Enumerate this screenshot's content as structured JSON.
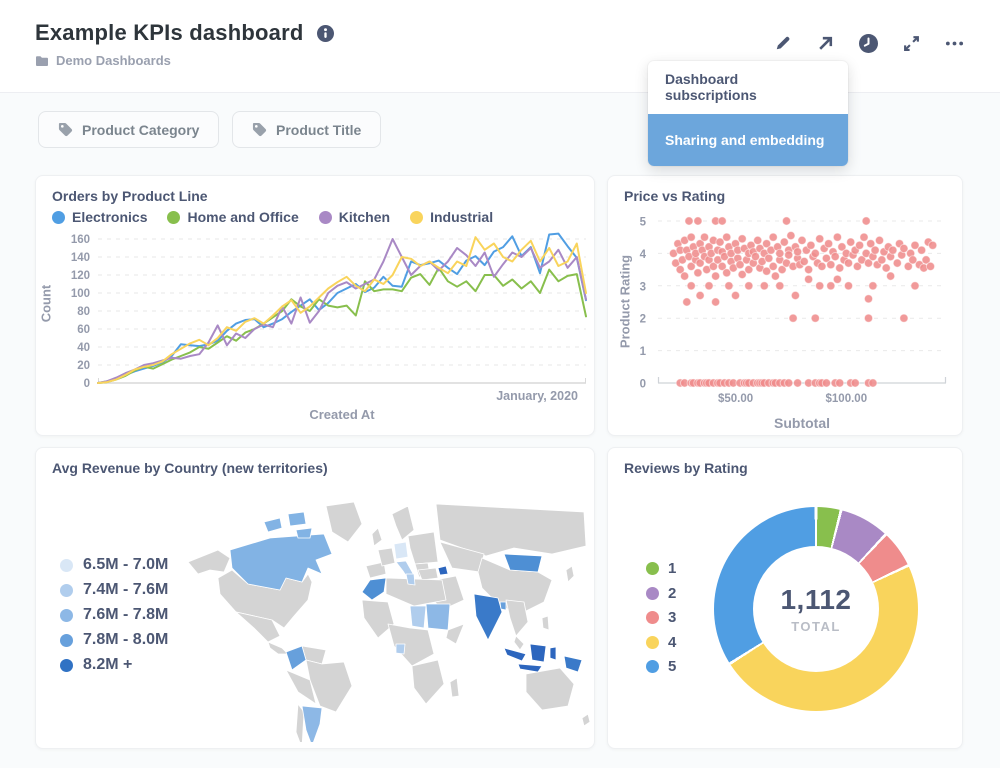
{
  "header": {
    "title": "Example KPIs dashboard",
    "breadcrumb": "Demo Dashboards",
    "actions": [
      "edit",
      "share",
      "time",
      "fullscreen",
      "more"
    ]
  },
  "menu": {
    "items": [
      {
        "label": "Dashboard subscriptions",
        "active": false
      },
      {
        "label": "Sharing and embedding",
        "active": true
      }
    ]
  },
  "filters": [
    {
      "label": "Product Category"
    },
    {
      "label": "Product Title"
    }
  ],
  "colors": {
    "brand": "#509ee3",
    "menu_highlight": "#6ca6dc",
    "map_base": "#d4d4d4"
  },
  "chart_data": [
    {
      "type": "line",
      "title": "Orders by Product Line",
      "xlabel": "Created At",
      "ylabel": "Count",
      "x_end_label": "January, 2020",
      "ylim": [
        0,
        170
      ],
      "yticks": [
        0,
        20,
        40,
        60,
        80,
        100,
        120,
        140,
        160
      ],
      "grid": true,
      "legend_position": "top",
      "series": [
        {
          "name": "Electronics",
          "color": "#509ee3",
          "values": [
            0,
            2,
            5,
            9,
            13,
            16,
            19,
            23,
            30,
            43,
            42,
            41,
            43,
            47,
            58,
            66,
            70,
            71,
            62,
            66,
            71,
            79,
            86,
            93,
            81,
            89,
            100,
            105,
            110,
            101,
            106,
            118,
            108,
            107,
            135,
            131,
            133,
            136,
            128,
            121,
            136,
            141,
            131,
            146,
            151,
            163,
            141,
            151,
            122,
            165,
            166,
            152,
            139,
            92
          ]
        },
        {
          "name": "Home and Office",
          "color": "#88bf4d",
          "values": [
            0,
            1,
            4,
            8,
            14,
            18,
            16,
            21,
            26,
            30,
            34,
            40,
            38,
            45,
            52,
            47,
            56,
            60,
            66,
            73,
            80,
            93,
            85,
            80,
            93,
            86,
            84,
            86,
            75,
            113,
            102,
            104,
            104,
            102,
            117,
            121,
            109,
            128,
            113,
            107,
            113,
            102,
            120,
            120,
            108,
            115,
            105,
            113,
            100,
            126,
            113,
            119,
            121,
            74
          ]
        },
        {
          "name": "Kitchen",
          "color": "#a989c5",
          "values": [
            0,
            2,
            6,
            11,
            15,
            20,
            22,
            25,
            28,
            27,
            30,
            32,
            45,
            64,
            42,
            55,
            50,
            60,
            65,
            62,
            85,
            66,
            95,
            67,
            80,
            100,
            108,
            112,
            105,
            110,
            115,
            135,
            160,
            140,
            120,
            130,
            135,
            125,
            135,
            150,
            142,
            130,
            145,
            118,
            132,
            145,
            140,
            150,
            128,
            135,
            148,
            128,
            140,
            93
          ]
        },
        {
          "name": "Industrial",
          "color": "#f9d45c",
          "values": [
            0,
            1,
            4,
            9,
            15,
            18,
            20,
            24,
            32,
            38,
            44,
            48,
            42,
            50,
            62,
            58,
            68,
            72,
            66,
            75,
            85,
            92,
            78,
            85,
            95,
            105,
            112,
            118,
            108,
            102,
            115,
            110,
            120,
            140,
            138,
            130,
            135,
            128,
            122,
            135,
            130,
            162,
            148,
            155,
            140,
            135,
            148,
            158,
            135,
            150,
            130,
            135,
            155,
            100
          ]
        }
      ]
    },
    {
      "type": "scatter",
      "title": "Price vs Rating",
      "xlabel": "Subtotal",
      "ylabel": "Product Rating",
      "color": "#ef8c8c",
      "xlim": [
        15,
        145
      ],
      "ylim": [
        0,
        5
      ],
      "yticks": [
        0,
        1,
        2,
        3,
        4,
        5
      ],
      "xticks": [
        {
          "v": 50,
          "label": "$50.00"
        },
        {
          "v": 100,
          "label": "$100.00"
        }
      ],
      "points": [
        [
          22,
          4.0
        ],
        [
          23,
          3.7
        ],
        [
          24,
          4.3
        ],
        [
          25,
          3.5
        ],
        [
          25,
          4.1
        ],
        [
          26,
          3.8
        ],
        [
          27,
          4.4
        ],
        [
          27,
          3.3
        ],
        [
          28,
          4.1
        ],
        [
          29,
          3.9
        ],
        [
          30,
          4.5
        ],
        [
          30,
          3.6
        ],
        [
          31,
          4.2
        ],
        [
          32,
          3.8
        ],
        [
          32,
          4.0
        ],
        [
          33,
          3.4
        ],
        [
          34,
          4.3
        ],
        [
          34,
          3.7
        ],
        [
          35,
          4.1
        ],
        [
          36,
          3.9
        ],
        [
          36,
          4.5
        ],
        [
          37,
          3.5
        ],
        [
          38,
          4.2
        ],
        [
          38,
          3.8
        ],
        [
          39,
          4.0
        ],
        [
          40,
          3.6
        ],
        [
          40,
          4.4
        ],
        [
          41,
          3.3
        ],
        [
          42,
          4.1
        ],
        [
          42,
          3.8
        ],
        [
          43,
          4.35
        ],
        [
          44,
          3.6
        ],
        [
          44,
          4.05
        ],
        [
          45,
          3.9
        ],
        [
          46,
          4.5
        ],
        [
          46,
          3.4
        ],
        [
          47,
          4.2
        ],
        [
          48,
          3.75
        ],
        [
          48,
          4.0
        ],
        [
          49,
          3.55
        ],
        [
          50,
          4.3
        ],
        [
          51,
          3.85
        ],
        [
          51,
          4.1
        ],
        [
          52,
          3.65
        ],
        [
          53,
          4.45
        ],
        [
          53,
          3.35
        ],
        [
          54,
          4.15
        ],
        [
          55,
          3.8
        ],
        [
          56,
          4.0
        ],
        [
          56,
          3.5
        ],
        [
          57,
          4.25
        ],
        [
          58,
          3.7
        ],
        [
          58,
          4.05
        ],
        [
          59,
          3.9
        ],
        [
          60,
          4.4
        ],
        [
          61,
          3.55
        ],
        [
          61,
          4.15
        ],
        [
          62,
          3.75
        ],
        [
          63,
          4.0
        ],
        [
          64,
          3.45
        ],
        [
          64,
          4.3
        ],
        [
          65,
          3.85
        ],
        [
          66,
          4.1
        ],
        [
          67,
          3.6
        ],
        [
          67,
          4.5
        ],
        [
          68,
          3.3
        ],
        [
          69,
          4.2
        ],
        [
          70,
          3.8
        ],
        [
          70,
          4.0
        ],
        [
          71,
          3.5
        ],
        [
          72,
          4.35
        ],
        [
          73,
          3.7
        ],
        [
          74,
          4.1
        ],
        [
          74,
          3.95
        ],
        [
          75,
          4.55
        ],
        [
          76,
          3.6
        ],
        [
          77,
          4.2
        ],
        [
          78,
          3.85
        ],
        [
          78,
          4.05
        ],
        [
          79,
          3.65
        ],
        [
          80,
          4.4
        ],
        [
          81,
          3.75
        ],
        [
          82,
          4.1
        ],
        [
          83,
          3.5
        ],
        [
          84,
          4.25
        ],
        [
          85,
          3.9
        ],
        [
          86,
          4.0
        ],
        [
          87,
          3.7
        ],
        [
          88,
          4.45
        ],
        [
          89,
          3.6
        ],
        [
          90,
          4.15
        ],
        [
          91,
          3.85
        ],
        [
          92,
          4.3
        ],
        [
          93,
          3.65
        ],
        [
          94,
          4.05
        ],
        [
          95,
          3.9
        ],
        [
          96,
          4.5
        ],
        [
          97,
          3.55
        ],
        [
          98,
          4.2
        ],
        [
          99,
          3.8
        ],
        [
          100,
          4.0
        ],
        [
          101,
          3.7
        ],
        [
          102,
          4.35
        ],
        [
          103,
          3.95
        ],
        [
          104,
          4.1
        ],
        [
          105,
          3.6
        ],
        [
          106,
          4.25
        ],
        [
          107,
          3.8
        ],
        [
          108,
          4.5
        ],
        [
          109,
          4.0
        ],
        [
          110,
          3.7
        ],
        [
          111,
          4.3
        ],
        [
          112,
          3.9
        ],
        [
          113,
          4.1
        ],
        [
          114,
          3.65
        ],
        [
          115,
          4.4
        ],
        [
          116,
          3.8
        ],
        [
          117,
          4.05
        ],
        [
          118,
          3.55
        ],
        [
          119,
          4.2
        ],
        [
          120,
          3.9
        ],
        [
          121,
          4.1
        ],
        [
          123,
          3.7
        ],
        [
          124,
          4.3
        ],
        [
          125,
          3.95
        ],
        [
          126,
          4.15
        ],
        [
          128,
          3.6
        ],
        [
          129,
          4.0
        ],
        [
          130,
          3.8
        ],
        [
          131,
          4.25
        ],
        [
          133,
          3.65
        ],
        [
          134,
          4.1
        ],
        [
          135,
          3.55
        ],
        [
          136,
          3.8
        ],
        [
          137,
          4.35
        ],
        [
          138,
          3.6
        ],
        [
          139,
          4.25
        ],
        [
          25,
          0
        ],
        [
          27,
          0
        ],
        [
          30,
          0
        ],
        [
          31,
          0
        ],
        [
          33,
          0
        ],
        [
          34,
          0
        ],
        [
          36,
          0
        ],
        [
          37,
          0
        ],
        [
          38,
          0
        ],
        [
          40,
          0
        ],
        [
          42,
          0
        ],
        [
          43,
          0
        ],
        [
          45,
          0
        ],
        [
          47,
          0
        ],
        [
          49,
          0
        ],
        [
          52,
          0
        ],
        [
          54,
          0
        ],
        [
          55,
          0
        ],
        [
          56,
          0
        ],
        [
          58,
          0
        ],
        [
          60,
          0
        ],
        [
          61,
          0
        ],
        [
          62,
          0
        ],
        [
          63,
          0
        ],
        [
          65,
          0
        ],
        [
          67,
          0
        ],
        [
          68,
          0
        ],
        [
          70,
          0
        ],
        [
          72,
          0
        ],
        [
          74,
          0
        ],
        [
          78,
          0
        ],
        [
          83,
          0
        ],
        [
          86,
          0
        ],
        [
          88,
          0
        ],
        [
          89,
          0
        ],
        [
          91,
          0
        ],
        [
          95,
          0
        ],
        [
          97,
          0
        ],
        [
          102,
          0
        ],
        [
          104,
          0
        ],
        [
          110,
          0
        ],
        [
          112,
          0
        ],
        [
          29,
          5
        ],
        [
          33,
          5
        ],
        [
          41,
          5
        ],
        [
          44,
          5
        ],
        [
          73,
          5
        ],
        [
          109,
          5
        ],
        [
          28,
          2.5
        ],
        [
          34,
          2.7
        ],
        [
          41,
          2.5
        ],
        [
          50,
          2.7
        ],
        [
          77,
          2.7
        ],
        [
          110,
          2.6
        ],
        [
          76,
          2
        ],
        [
          86,
          2
        ],
        [
          110,
          2
        ],
        [
          126,
          2
        ],
        [
          30,
          3.0
        ],
        [
          38,
          3.0
        ],
        [
          47,
          3.0
        ],
        [
          56,
          3.0
        ],
        [
          63,
          3.0
        ],
        [
          70,
          3.0
        ],
        [
          88,
          3.0
        ],
        [
          93,
          3.0
        ],
        [
          101,
          3.0
        ],
        [
          112,
          3.0
        ],
        [
          131,
          3.0
        ],
        [
          83,
          3.2
        ],
        [
          96,
          3.2
        ],
        [
          120,
          3.3
        ]
      ]
    },
    {
      "type": "map",
      "title": "Avg Revenue by Country (new territories)",
      "legend": [
        {
          "label": "6.5M - 7.0M",
          "color": "#d9e7f6"
        },
        {
          "label": "7.4M - 7.6M",
          "color": "#b0cded"
        },
        {
          "label": "7.6M - 7.8M",
          "color": "#8db8e6"
        },
        {
          "label": "7.8M - 8.0M",
          "color": "#67a0dc"
        },
        {
          "label": "8.2M +",
          "color": "#3072c4"
        }
      ]
    },
    {
      "type": "pie",
      "title": "Reviews by Rating",
      "categories": [
        "1",
        "2",
        "3",
        "4",
        "5"
      ],
      "values": [
        44,
        89,
        67,
        534,
        378
      ],
      "colors": [
        "#88bf4d",
        "#a989c5",
        "#ef8c8c",
        "#f9d45c",
        "#509ee3"
      ],
      "total_display": "1,112",
      "total_label": "TOTAL"
    }
  ]
}
